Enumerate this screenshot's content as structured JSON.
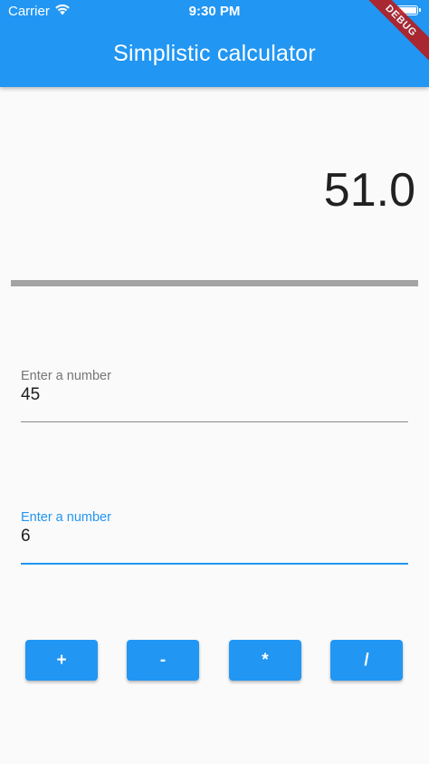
{
  "status_bar": {
    "carrier": "Carrier",
    "time": "9:30 PM",
    "icons": [
      "wifi-icon",
      "battery-icon"
    ]
  },
  "app_bar": {
    "title": "Simplistic calculator",
    "color": "#2196f3"
  },
  "debug_banner": {
    "label": "DEBUG",
    "color": "#b71c1c"
  },
  "result": {
    "value": "51.0"
  },
  "inputs": [
    {
      "label": "Enter a number",
      "value": "45",
      "focused": false
    },
    {
      "label": "Enter a number",
      "value": "6",
      "focused": true
    }
  ],
  "operators": [
    {
      "label": "+"
    },
    {
      "label": "-"
    },
    {
      "label": "*"
    },
    {
      "label": "/"
    }
  ],
  "colors": {
    "accent": "#2196f3",
    "background": "#fafafa",
    "divider": "#a4a4a4"
  }
}
